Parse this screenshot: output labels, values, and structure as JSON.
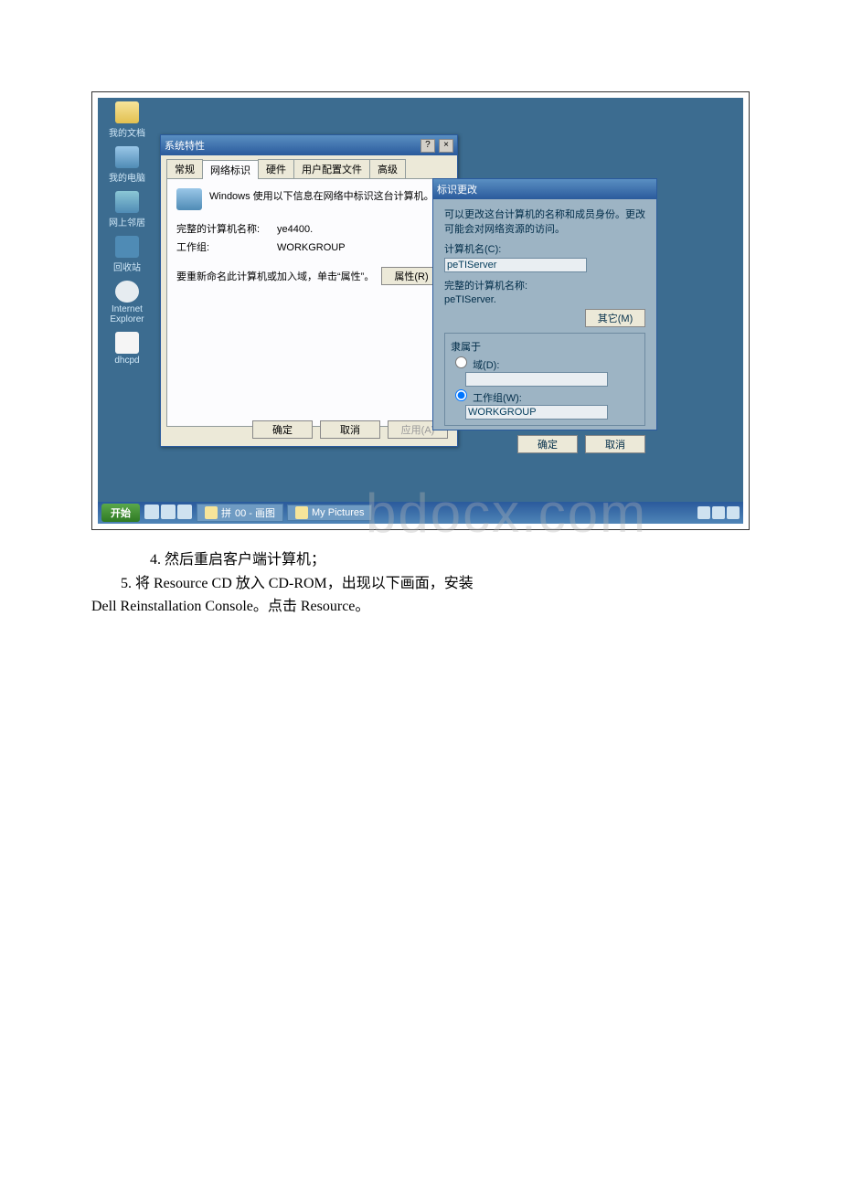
{
  "desktop": {
    "icons": [
      {
        "label": "我的文档"
      },
      {
        "label": "我的电脑"
      },
      {
        "label": "网上邻居"
      },
      {
        "label": "回收站"
      },
      {
        "label": "Internet Explorer"
      },
      {
        "label": "dhcpd"
      }
    ]
  },
  "sysprops": {
    "title": "系统特性",
    "tabs": {
      "general": "常规",
      "netid": "网络标识",
      "hardware": "硬件",
      "profiles": "用户配置文件",
      "advanced": "高级"
    },
    "msg": "Windows 使用以下信息在网络中标识这台计算机。",
    "fullname_label": "完整的计算机名称:",
    "fullname_value": "ye4400.",
    "workgroup_label": "工作组:",
    "workgroup_value": "WORKGROUP",
    "rename_msg": "要重新命名此计算机或加入域，单击“属性”。",
    "props_btn": "属性(R)",
    "ok": "确定",
    "cancel": "取消",
    "apply": "应用(A)"
  },
  "idchange": {
    "title": "标识更改",
    "desc": "可以更改这台计算机的名称和成员身份。更改可能会对网络资源的访问。",
    "compname_label": "计算机名(C):",
    "compname_value": "peTIServer",
    "fullname_label": "完整的计算机名称:",
    "fullname_value": "peTIServer.",
    "more_btn": "其它(M)",
    "memberof": "隶属于",
    "domain_label": "域(D):",
    "domain_value": "",
    "workgroup_label": "工作组(W):",
    "workgroup_value": "WORKGROUP",
    "ok": "确定",
    "cancel": "取消"
  },
  "taskbar": {
    "start": "开始",
    "lang": "拼",
    "taskbtn1": "00 - 画图",
    "taskbtn2": "My Pictures"
  },
  "bodytext": {
    "step4": "4. 然后重启客户端计算机；",
    "step5": "5. 将 Resource CD 放入 CD-ROM，出现以下画面，安装",
    "step5b": "Dell Reinstallation Console。点击 Resource。"
  },
  "watermark": "bdocx.com"
}
